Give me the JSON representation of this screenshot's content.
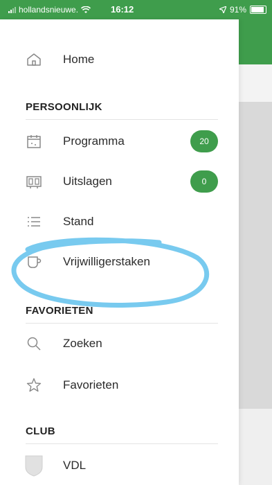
{
  "status_bar": {
    "carrier": "hollandsnieuwe.",
    "time": "16:12",
    "battery": "91%"
  },
  "menu": {
    "home": "Home",
    "sections": {
      "persoonlijk": "PERSOONLIJK",
      "favorieten": "FAVORIETEN",
      "club": "CLUB"
    },
    "programma": {
      "label": "Programma",
      "badge": "20"
    },
    "uitslagen": {
      "label": "Uitslagen",
      "badge": "0"
    },
    "stand": "Stand",
    "vrijwilligerstaken": "Vrijwilligerstaken",
    "zoeken": "Zoeken",
    "favorieten_item": "Favorieten",
    "club_item": "VDL"
  },
  "colors": {
    "accent": "#3f9d4c",
    "annotation": "#6cc6ee"
  },
  "icons": [
    "signal-icon",
    "wifi-icon",
    "location-icon",
    "battery-icon",
    "home-icon",
    "calendar-icon",
    "scoreboard-icon",
    "list-icon",
    "cup-icon",
    "search-icon",
    "star-icon",
    "club-shield-icon"
  ]
}
